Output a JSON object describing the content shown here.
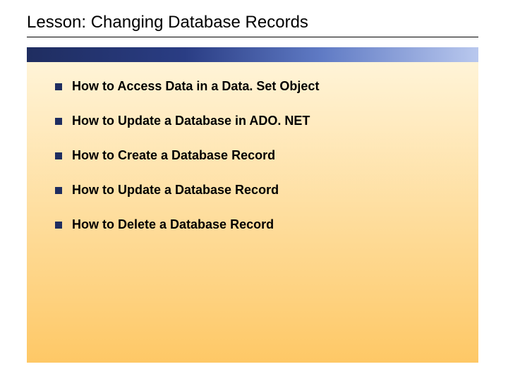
{
  "title": "Lesson: Changing Database Records",
  "items": [
    {
      "label": "How to Access Data in a Data. Set Object"
    },
    {
      "label": "How to Update a Database in ADO. NET"
    },
    {
      "label": "How to Create a Database Record"
    },
    {
      "label": "How to Update a Database Record"
    },
    {
      "label": "How to Delete a Database Record"
    }
  ]
}
